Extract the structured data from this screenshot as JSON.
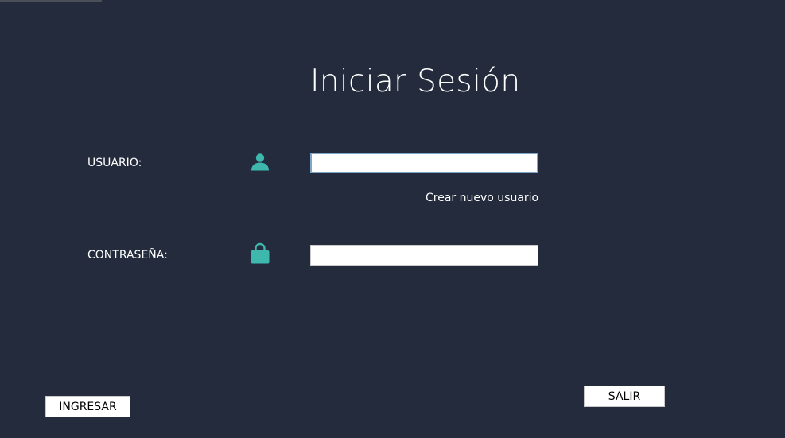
{
  "login": {
    "title": "Iniciar Sesión",
    "user_label": "USUARIO:",
    "user_value": "",
    "user_icon": "user-icon",
    "create_user_link": "Crear nuevo usuario",
    "password_label": "CONTRASEÑA:",
    "password_value": "",
    "password_icon": "lock-icon",
    "submit_label": "INGRESAR",
    "exit_label": "SALIR"
  },
  "colors": {
    "background": "#232b3d",
    "icon_accent": "#3eb8ad",
    "text": "#ffffff",
    "focus_border": "#7fa6cc"
  }
}
